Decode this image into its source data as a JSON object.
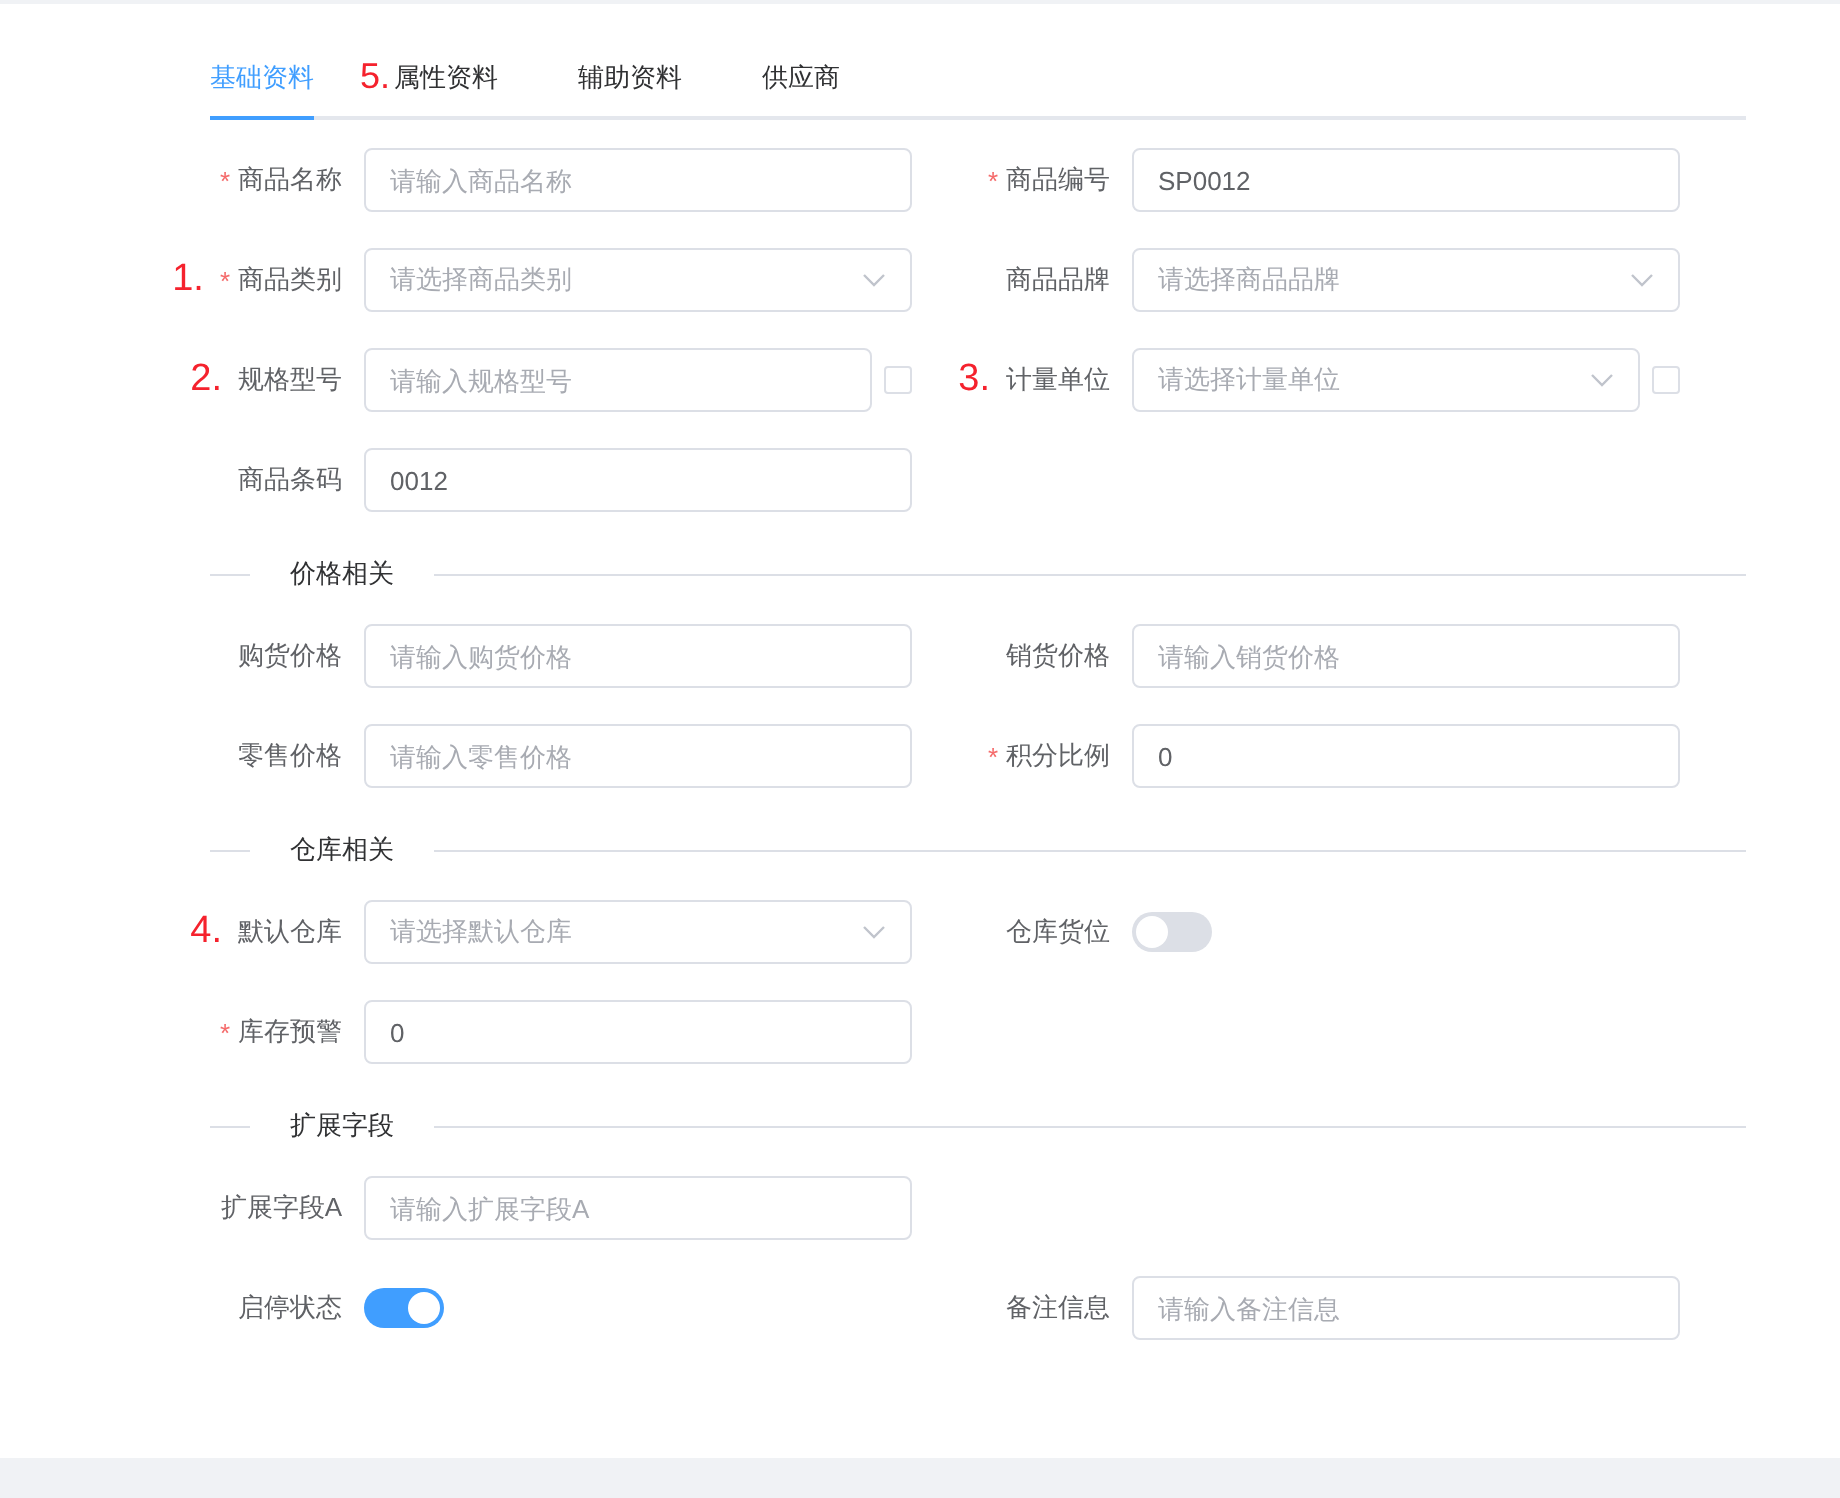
{
  "tabs": [
    {
      "label": "基础资料",
      "selected": true
    },
    {
      "label": "属性资料",
      "selected": false,
      "annotation": "5."
    },
    {
      "label": "辅助资料",
      "selected": false
    },
    {
      "label": "供应商",
      "selected": false
    }
  ],
  "sections": [
    {
      "rows": [
        {
          "fields": [
            {
              "kind": "input",
              "label": "商品名称",
              "required_mark": "*",
              "placeholder": "请输入商品名称"
            },
            {
              "kind": "input",
              "label": "商品编号",
              "required_mark": "*",
              "value": "SP0012"
            }
          ]
        },
        {
          "fields": [
            {
              "kind": "select",
              "label": "商品类别",
              "required_mark": "*",
              "placeholder": "请选择商品类别",
              "annotation": "1."
            },
            {
              "kind": "select",
              "label": "商品品牌",
              "placeholder": "请选择商品品牌"
            }
          ]
        },
        {
          "fields": [
            {
              "kind": "input",
              "label": "规格型号",
              "placeholder": "请输入规格型号",
              "annotation": "2.",
              "checkbox": {
                "checked": false
              }
            },
            {
              "kind": "select",
              "label": "计量单位",
              "placeholder": "请选择计量单位",
              "annotation": "3.",
              "checkbox": {
                "checked": false
              }
            }
          ]
        },
        {
          "fields": [
            {
              "kind": "input",
              "label": "商品条码",
              "value": "0012"
            }
          ]
        }
      ]
    },
    {
      "title": "价格相关",
      "rows": [
        {
          "fields": [
            {
              "kind": "input",
              "label": "购货价格",
              "placeholder": "请输入购货价格"
            },
            {
              "kind": "input",
              "label": "销货价格",
              "placeholder": "请输入销货价格"
            }
          ]
        },
        {
          "fields": [
            {
              "kind": "input",
              "label": "零售价格",
              "placeholder": "请输入零售价格"
            },
            {
              "kind": "input",
              "label": "积分比例",
              "required_mark": "*",
              "value": "0"
            }
          ]
        }
      ]
    },
    {
      "title": "仓库相关",
      "rows": [
        {
          "fields": [
            {
              "kind": "select",
              "label": "默认仓库",
              "placeholder": "请选择默认仓库",
              "annotation": "4."
            },
            {
              "kind": "switch",
              "label": "仓库货位",
              "on": false
            }
          ]
        },
        {
          "fields": [
            {
              "kind": "input",
              "label": "库存预警",
              "required_mark": "*",
              "value": "0"
            }
          ]
        }
      ]
    },
    {
      "title": "扩展字段",
      "rows": [
        {
          "fields": [
            {
              "kind": "input",
              "label": "扩展字段A",
              "placeholder": "请输入扩展字段A"
            }
          ]
        },
        {
          "fields": [
            {
              "kind": "switch",
              "label": "启停状态",
              "on": true
            },
            {
              "kind": "input",
              "label": "备注信息",
              "placeholder": "请输入备注信息"
            }
          ]
        }
      ]
    }
  ]
}
